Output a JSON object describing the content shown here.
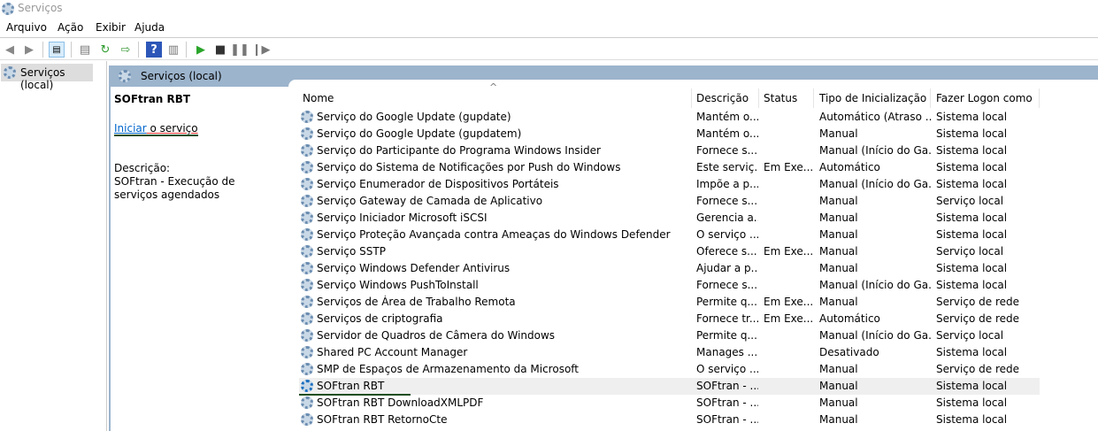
{
  "window": {
    "title": "Serviços"
  },
  "menu": [
    "Arquivo",
    "Ação",
    "Exibir",
    "Ajuda"
  ],
  "tree": {
    "item": "Serviços (local)"
  },
  "panel": {
    "title": "Serviços (local)"
  },
  "detail": {
    "name": "SOFtran RBT",
    "start_link": "Iniciar",
    "start_rest": " o serviço",
    "desc_label": "Descrição:",
    "desc_text": "SOFtran - Execução de serviços agendados"
  },
  "columns": [
    "Nome",
    "Descrição",
    "Status",
    "Tipo de Inicialização",
    "Fazer Logon como"
  ],
  "rows": [
    [
      "Serviço do Google Update (gupdate)",
      "Mantém o...",
      "",
      "Automático (Atraso ...",
      "Sistema local"
    ],
    [
      "Serviço do Google Update (gupdatem)",
      "Mantém o...",
      "",
      "Manual",
      "Sistema local"
    ],
    [
      "Serviço do Participante do Programa Windows Insider",
      "Fornece s...",
      "",
      "Manual (Início do Ga...",
      "Sistema local"
    ],
    [
      "Serviço do Sistema de Notificações por Push do Windows",
      "Este serviç...",
      "Em Exe...",
      "Automático",
      "Sistema local"
    ],
    [
      "Serviço Enumerador de Dispositivos Portáteis",
      "Impõe a p...",
      "",
      "Manual (Início do Ga...",
      "Sistema local"
    ],
    [
      "Serviço Gateway de Camada de Aplicativo",
      "Fornece s...",
      "",
      "Manual",
      "Serviço local"
    ],
    [
      "Serviço Iniciador Microsoft iSCSI",
      "Gerencia a...",
      "",
      "Manual",
      "Sistema local"
    ],
    [
      "Serviço Proteção Avançada contra Ameaças do Windows Defender",
      "O serviço ...",
      "",
      "Manual",
      "Sistema local"
    ],
    [
      "Serviço SSTP",
      "Oferece s...",
      "Em Exe...",
      "Manual",
      "Serviço local"
    ],
    [
      "Serviço Windows Defender Antivirus",
      "Ajudar a p...",
      "",
      "Manual",
      "Sistema local"
    ],
    [
      "Serviço Windows PushToInstall",
      "Fornece s...",
      "",
      "Manual (Início do Ga...",
      "Sistema local"
    ],
    [
      "Serviços de Área de Trabalho Remota",
      "Permite q...",
      "Em Exe...",
      "Manual",
      "Serviço de rede"
    ],
    [
      "Serviços de criptografia",
      "Fornece tr...",
      "Em Exe...",
      "Automático",
      "Serviço de rede"
    ],
    [
      "Servidor de Quadros de Câmera do Windows",
      "Permite q...",
      "",
      "Manual (Início do Ga...",
      "Serviço local"
    ],
    [
      "Shared PC Account Manager",
      "Manages ...",
      "",
      "Desativado",
      "Sistema local"
    ],
    [
      "SMP de Espaços de Armazenamento da Microsoft",
      "O serviço ...",
      "",
      "Manual",
      "Serviço de rede"
    ],
    [
      "SOFtran RBT",
      "SOFtran - ...",
      "",
      "Manual",
      "Sistema local"
    ],
    [
      "SOFtran RBT DownloadXMLPDF",
      "SOFtran - ...",
      "",
      "Manual",
      "Sistema local"
    ],
    [
      "SOFtran RBT RetornoCte",
      "SOFtran - ...",
      "",
      "Manual",
      "Sistema local"
    ]
  ],
  "selected_row": 16
}
